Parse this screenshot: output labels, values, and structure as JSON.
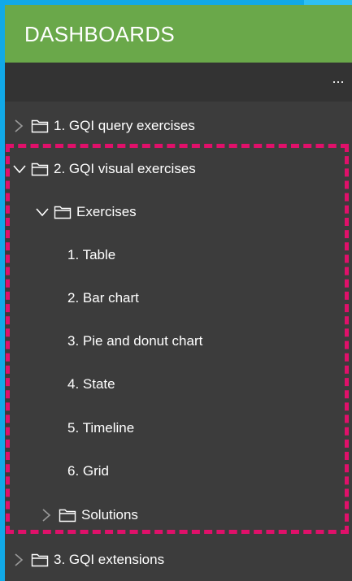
{
  "header": {
    "title": "DASHBOARDS"
  },
  "toolbar": {
    "more_label": "..."
  },
  "tree": {
    "folder_1": {
      "label": "1. GQI query exercises"
    },
    "folder_2": {
      "label": "2. GQI visual exercises",
      "exercises": {
        "label": "Exercises",
        "items": [
          "1. Table",
          "2. Bar chart",
          "3. Pie and donut chart",
          "4. State",
          "5. Timeline",
          "6. Grid"
        ]
      },
      "solutions": {
        "label": "Solutions"
      }
    },
    "folder_3": {
      "label": "3. GQI extensions"
    }
  },
  "colors": {
    "header_bg": "#6aa84a",
    "panel_bg": "#3c3c3c",
    "toolbar_bg": "#333333",
    "highlight": "#e0106a",
    "edge": "#11a9e8"
  },
  "icons": {
    "collapsed": "chevron-right-icon",
    "expanded": "chevron-down-icon",
    "folder": "folder-icon",
    "more": "more-icon"
  }
}
